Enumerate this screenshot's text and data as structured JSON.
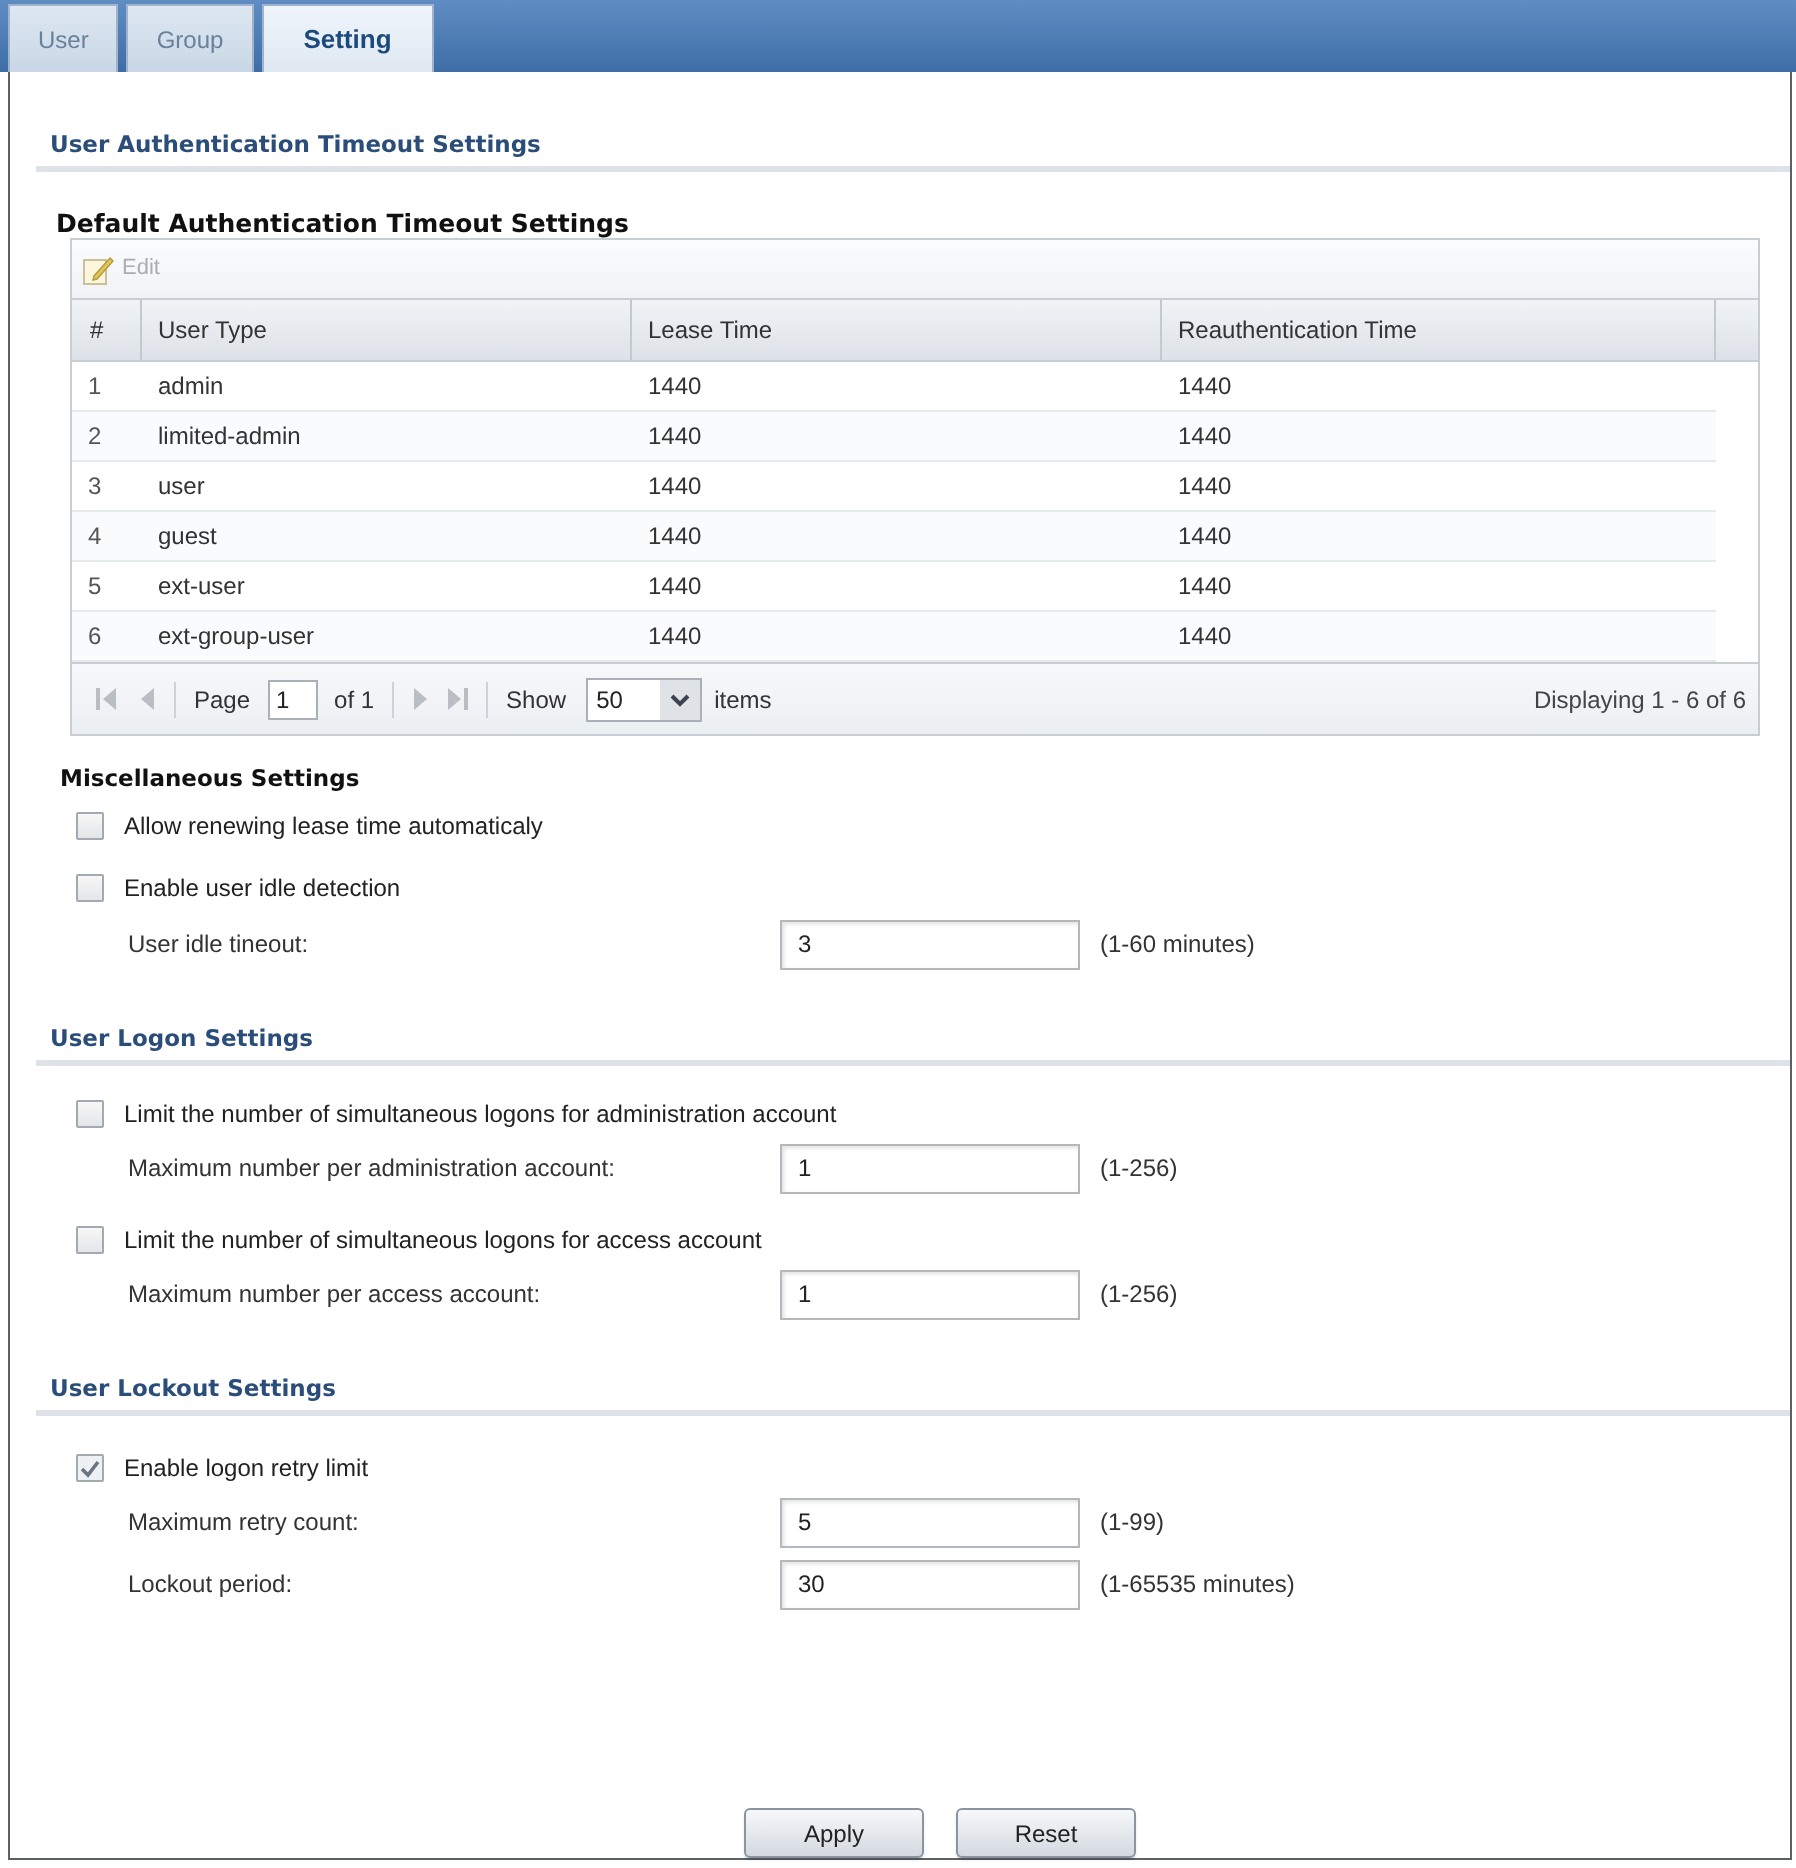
{
  "tabs": [
    {
      "label": "User",
      "selected": false
    },
    {
      "label": "Group",
      "selected": false
    },
    {
      "label": "Setting",
      "selected": true
    }
  ],
  "auth_timeout": {
    "title": "User Authentication Timeout Settings",
    "subtitle": "Default Authentication Timeout Settings",
    "edit_button": {
      "label": "Edit",
      "disabled": true
    },
    "table": {
      "columns": [
        "#",
        "User Type",
        "Lease Time",
        "Reauthentication Time"
      ],
      "rows": [
        [
          "1",
          "admin",
          "1440",
          "1440"
        ],
        [
          "2",
          "limited-admin",
          "1440",
          "1440"
        ],
        [
          "3",
          "user",
          "1440",
          "1440"
        ],
        [
          "4",
          "guest",
          "1440",
          "1440"
        ],
        [
          "5",
          "ext-user",
          "1440",
          "1440"
        ],
        [
          "6",
          "ext-group-user",
          "1440",
          "1440"
        ]
      ]
    },
    "pagination": {
      "page_label": "Page",
      "page": "1",
      "page_count": "of 1",
      "show_label": "Show",
      "page_size": "50",
      "items_label": "items",
      "summary": "Displaying 1 - 6 of 6"
    }
  },
  "misc_settings": {
    "title": "Miscellaneous Settings",
    "items": [
      {
        "kind": "checkbox",
        "label": "Allow renewing lease time automaticaly",
        "checked": false
      },
      {
        "kind": "checkbox",
        "label": "Enable user idle detection",
        "checked": false
      },
      {
        "kind": "field",
        "label": "User idle tineout:",
        "value": "3",
        "hint": "(1-60 minutes)"
      }
    ]
  },
  "logon_settings": {
    "title": "User Logon Settings",
    "items": [
      {
        "kind": "checkbox",
        "label": "Limit the number of simultaneous logons for administration account",
        "checked": false
      },
      {
        "kind": "field",
        "label": "Maximum number per administration account:",
        "value": "1",
        "hint": "(1-256)"
      },
      {
        "kind": "checkbox",
        "label": "Limit the number of simultaneous logons for access account",
        "checked": false
      },
      {
        "kind": "field",
        "label": "Maximum number per access account:",
        "value": "1",
        "hint": "(1-256)"
      }
    ]
  },
  "lockout_settings": {
    "title": "User Lockout Settings",
    "items": [
      {
        "kind": "checkbox",
        "label": "Enable logon retry limit",
        "checked": true
      },
      {
        "kind": "field",
        "label": "Maximum retry count:",
        "value": "5",
        "hint": "(1-99)"
      },
      {
        "kind": "field",
        "label": "Lockout period:",
        "value": "30",
        "hint": "(1-65535 minutes)"
      }
    ]
  },
  "buttons": [
    {
      "label": "Apply"
    },
    {
      "label": "Reset"
    }
  ]
}
